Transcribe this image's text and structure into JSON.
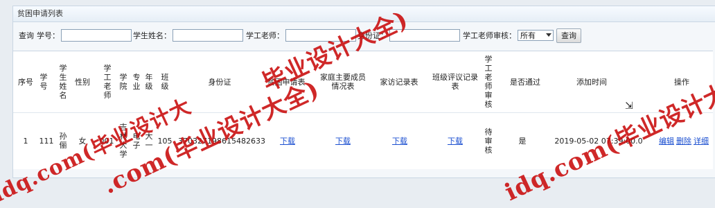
{
  "panel_title": "贫困申请列表",
  "search": {
    "query_label": "查询",
    "student_id_label": "学号：",
    "student_name_label": "学生姓名：",
    "teacher_label": "学工老师：",
    "id_card_label": "身份证：",
    "review_label": "学工老师审核：",
    "review_value": "所有",
    "button_label": "查询"
  },
  "columns": [
    "序号",
    "学号",
    "学生姓名",
    "性别",
    "学工老师",
    "学院",
    "专业",
    "年级",
    "班级",
    "身份证",
    "贫困申请表",
    "家庭主要成员情况表",
    "家访记录表",
    "班级评议记录表",
    "学工老师审核",
    "是否通过",
    "添加时间",
    "操作"
  ],
  "rows": [
    {
      "no": "1",
      "student_id": "111",
      "name": "孙俪",
      "gender": "女",
      "teacher": "001",
      "college": "吉林大学",
      "major": "电子",
      "grade": "大一",
      "class": "105",
      "id_card": "370327198615482633",
      "poverty_form": "下载",
      "family_form": "下载",
      "visit_form": "下载",
      "class_review": "下载",
      "teacher_review": "待审核",
      "passed": "是",
      "added_time": "2019-05-02 07:39:00.0",
      "action_edit": "编辑",
      "action_delete": "删除",
      "action_detail": "详细"
    }
  ],
  "watermark": {
    "text1": "毕业设计大全)",
    "text2": ".com(毕业设计大全)",
    "text3": "idq.com(毕业设计大",
    "text4": "idq.com(毕业设计大",
    "color": "#c80a0a"
  }
}
